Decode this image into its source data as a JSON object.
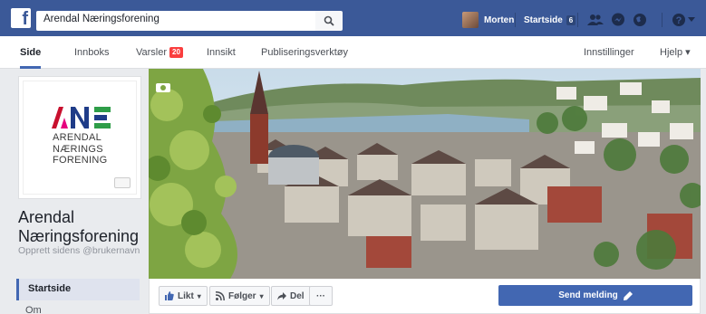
{
  "topbar": {
    "search_value": "Arendal Næringsforening",
    "user_name": "Morten",
    "home_label": "Startside",
    "home_badge": "6"
  },
  "tabs": [
    {
      "label": "Side"
    },
    {
      "label": "Innboks"
    },
    {
      "label": "Varsler",
      "badge": "20"
    },
    {
      "label": "Innsikt"
    },
    {
      "label": "Publiseringsverktøy"
    },
    {
      "label": "Innstillinger"
    },
    {
      "label": "Hjelp ▾"
    }
  ],
  "profile": {
    "logo_lines": [
      "ARENDAL",
      "NÆRINGS",
      "FORENING"
    ],
    "logo_colors": [
      "#c8102e",
      "#1f3c88",
      "#2e9d48",
      "#e6007e"
    ],
    "page_name": "Arendal Næringsforening",
    "username_hint": "Opprett sidens @brukernavn"
  },
  "left_nav": {
    "active": "Startside",
    "next": "Om"
  },
  "actions": {
    "like": "Likt",
    "follow": "Følger",
    "share": "Del",
    "more": "···",
    "send_message": "Send melding"
  },
  "icons": [
    "facebook-logo-icon",
    "search-icon",
    "friends-icon",
    "messages-icon",
    "globe-icon",
    "help-icon",
    "camera-icon",
    "like-icon",
    "follow-icon",
    "share-icon",
    "pencil-icon"
  ]
}
